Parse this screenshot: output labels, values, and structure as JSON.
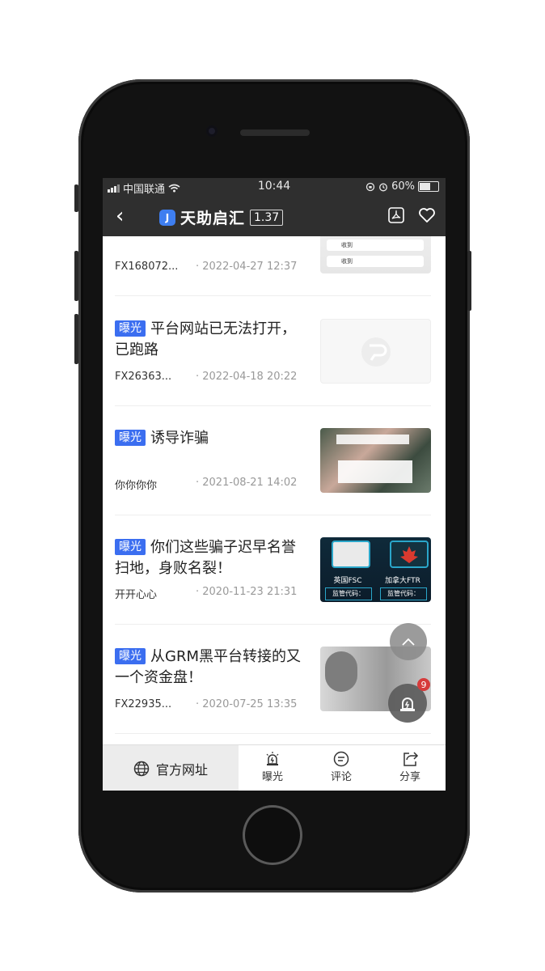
{
  "status": {
    "carrier": "中国联通",
    "time": "10:44",
    "battery": "60%",
    "battery_level": 0.6
  },
  "header": {
    "app_name": "天助启汇",
    "score": "1.37",
    "back_icon": "back-chevron-icon",
    "icons": [
      "pdf-icon",
      "heart-icon"
    ]
  },
  "items": [
    {
      "tag": "",
      "title": "",
      "author": "FX168072...",
      "date": "2022-04-27 12:37",
      "thumb_text": [
        "收到",
        "收到"
      ]
    },
    {
      "tag": "曝光",
      "title": "平台网站已无法打开，已跑路",
      "author": "FX26363...",
      "date": "2022-04-18 20:22"
    },
    {
      "tag": "曝光",
      "title": "诱导诈骗",
      "author": "你你你你",
      "date": "2021-08-21 14:02"
    },
    {
      "tag": "曝光",
      "title": "你们这些骗子迟早名誉扫地，身败名裂！",
      "author": "开开心心",
      "date": "2020-11-23 21:31",
      "thumb_labels": [
        "英国FSC",
        "加拿大FTR",
        "监管代码：",
        "监管代码："
      ]
    },
    {
      "tag": "曝光",
      "title": "从GRM黑平台转接的又一个资金盘！",
      "author": "FX22935...",
      "date": "2020-07-25 13:35"
    }
  ],
  "floating": {
    "alert_count": "9"
  },
  "bottom_bar": {
    "official_site": "官方网址",
    "tabs": [
      {
        "label": "曝光",
        "icon": "alarm-icon"
      },
      {
        "label": "评论",
        "icon": "comment-icon"
      },
      {
        "label": "分享",
        "icon": "share-icon"
      }
    ]
  }
}
